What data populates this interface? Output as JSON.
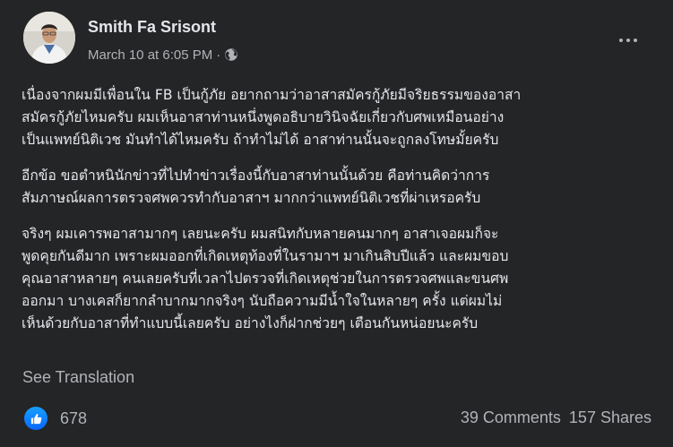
{
  "post": {
    "author": "Smith Fa Srisont",
    "timestamp": "March 10 at 6:05 PM",
    "separator": "·",
    "privacy_icon": "globe-icon",
    "paragraphs": [
      [
        "เนื่องจากผมมีเพื่อนใน FB เป็นกู้ภัย อยากถามว่าอาสาสมัครกู้ภัยมีจริยธรรมของอาสา",
        "สมัครกู้ภัยไหมครับ ผมเห็นอาสาท่านหนึ่งพูดอธิบายวินิจฉัยเกี่ยวกับศพเหมือนอย่าง",
        "เป็นแพทย์นิติเวช มันทำได้ไหมครับ ถ้าทำไม่ได้ อาสาท่านนั้นจะถูกลงโทษมั้ยครับ"
      ],
      [
        "อีกข้อ ขอตำหนินักข่าวที่ไปทำข่าวเรื่องนี้กับอาสาท่านนั้นด้วย คือท่านคิดว่าการ",
        "สัมภาษณ์ผลการตรวจศพควรทำกับอาสาฯ มากกว่าแพทย์นิติเวชที่ผ่าเหรอครับ"
      ],
      [
        "จริงๆ ผมเคารพอาสามากๆ เลยนะครับ ผมสนิทกับหลายคนมากๆ อาสาเจอผมก็จะ",
        "พูดคุยกันดีมาก เพราะผมออกที่เกิดเหตุท้องที่ในรามาฯ มาเกินสิบปีแล้ว และผมขอบ",
        "คุณอาสาหลายๆ คนเลยครับที่เวลาไปตรวจที่เกิดเหตุช่วยในการตรวจศพและขนศพ",
        "ออกมา บางเคสก็ยากลำบากมากจริงๆ นับถือความมีน้ำใจในหลายๆ ครั้ง แต่ผมไม่",
        "เห็นด้วยกับอาสาที่ทำแบบนี้เลยครับ อย่างไงก็ฝากช่วยๆ เตือนกันหน่อยนะครับ"
      ]
    ],
    "see_translation": "See Translation",
    "like_count": "678",
    "comments": "39 Comments",
    "shares": "157 Shares"
  },
  "colors": {
    "background": "#242526",
    "primary_text": "#e4e6eb",
    "secondary_text": "#b0b3b8",
    "like_blue": "#0866ff"
  }
}
